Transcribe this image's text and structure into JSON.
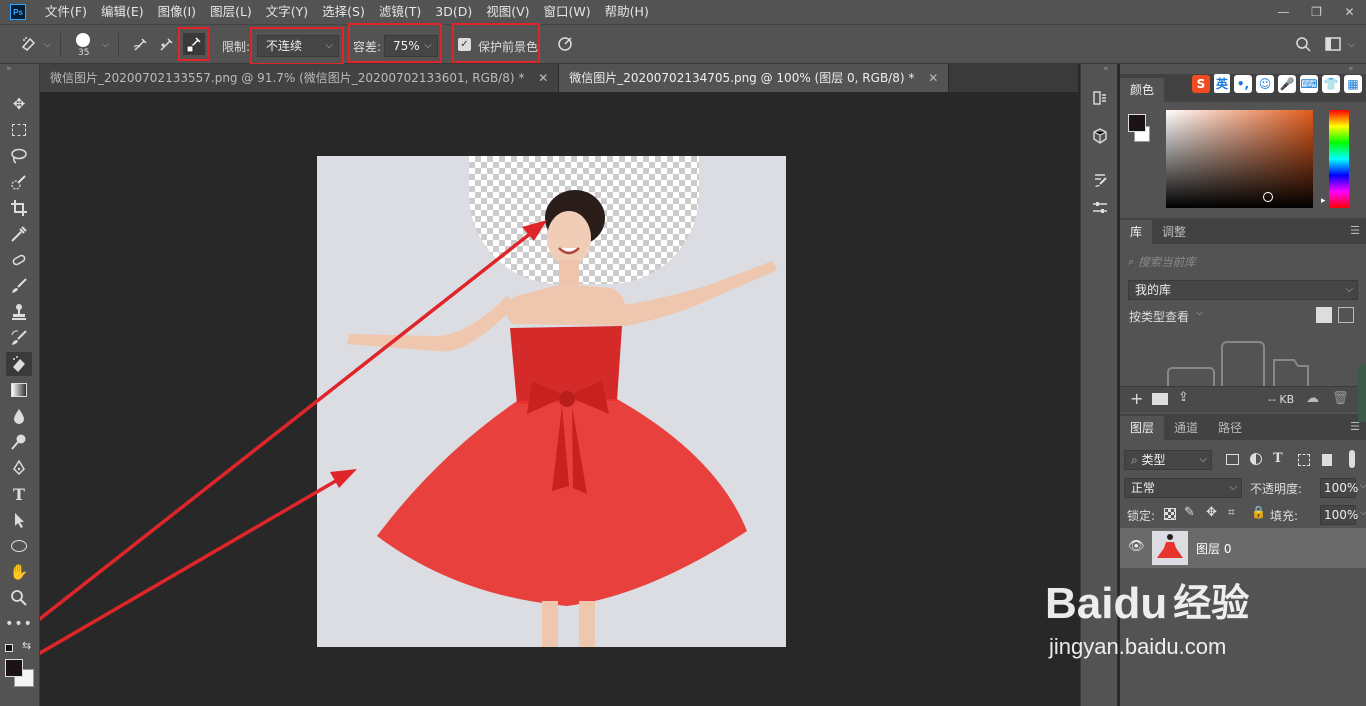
{
  "app": {
    "logo": "Ps"
  },
  "menu": [
    "文件(F)",
    "编辑(E)",
    "图像(I)",
    "图层(L)",
    "文字(Y)",
    "选择(S)",
    "滤镜(T)",
    "3D(D)",
    "视图(V)",
    "窗口(W)",
    "帮助(H)"
  ],
  "window_controls": {
    "minimize": "—",
    "restore": "❐",
    "close": "✕"
  },
  "options": {
    "brush_size": "35",
    "limit_label": "限制:",
    "limit_value": "不连续",
    "tolerance_label": "容差:",
    "tolerance_value": "75%",
    "protect_label": "保护前景色",
    "protect_checked": true
  },
  "tabs": [
    {
      "label": "微信图片_20200702133557.png @ 91.7% (微信图片_20200702133601, RGB/8) *",
      "active": false
    },
    {
      "label": "微信图片_20200702134705.png @ 100% (图层 0, RGB/8) *",
      "active": true
    }
  ],
  "tab_close": "✕",
  "color_panel": {
    "title": "颜色",
    "ime_label": "英"
  },
  "library_panel": {
    "tabs": [
      "库",
      "调整"
    ],
    "search_placeholder": "搜索当前库",
    "library_select": "我的库",
    "view_by": "按类型查看",
    "size": "-- KB"
  },
  "layers_panel": {
    "tabs": [
      "图层",
      "通道",
      "路径"
    ],
    "filter_type": "类型",
    "blend_mode": "正常",
    "opacity_label": "不透明度:",
    "opacity_value": "100%",
    "lock_label": "锁定:",
    "fill_label": "填充:",
    "fill_value": "100%",
    "layer_name": "图层 0"
  },
  "watermark": {
    "brand": "Baidu",
    "brand_cn": "经验",
    "url": "jingyan.baidu.com"
  },
  "colors": {
    "annotation_red": "#e0252a",
    "panel_bg": "#535353",
    "canvas_bg": "#282828",
    "dress_red": "#e8332f"
  }
}
